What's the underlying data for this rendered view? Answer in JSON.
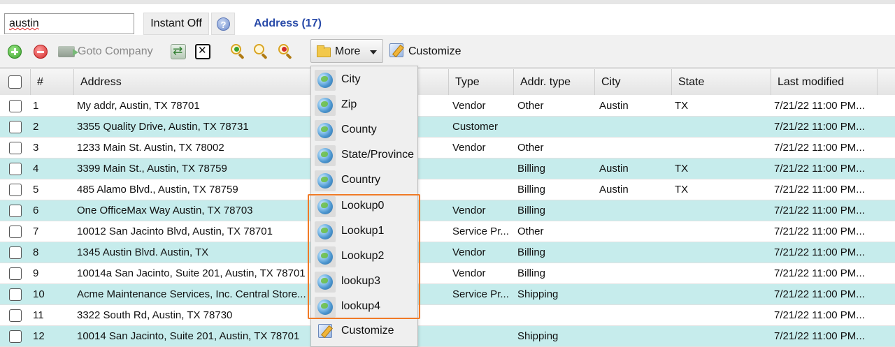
{
  "search": {
    "value": "austin"
  },
  "topbar": {
    "instant_label": "Instant Off",
    "help_glyph": "?",
    "title": "Address (17)"
  },
  "toolbar": {
    "goto_label": "Goto Company",
    "more_label": "More",
    "customize_label": "Customize",
    "icons": [
      "add-icon",
      "remove-icon",
      "goto-company-icon",
      "refresh-icon",
      "clear-icon",
      "search-add-icon",
      "search-icon",
      "search-remove-icon",
      "folder-icon",
      "customize-icon"
    ]
  },
  "table": {
    "columns": [
      "#",
      "Address",
      "Type",
      "Addr. type",
      "City",
      "State",
      "Last modified"
    ],
    "rows": [
      [
        "1",
        "My addr, Austin, TX 78701",
        "Vendor",
        "Other",
        "Austin",
        "TX",
        "7/21/22 11:00 PM..."
      ],
      [
        "2",
        "3355 Quality Drive, Austin, TX 78731",
        "Customer",
        "",
        "",
        "",
        "7/21/22 11:00 PM..."
      ],
      [
        "3",
        "1233 Main St. Austin, TX 78002",
        "Vendor",
        "Other",
        "",
        "",
        "7/21/22 11:00 PM..."
      ],
      [
        "4",
        "3399 Main St., Austin, TX 78759",
        "",
        "Billing",
        "Austin",
        "TX",
        "7/21/22 11:00 PM..."
      ],
      [
        "5",
        "485 Alamo Blvd., Austin, TX 78759",
        "",
        "Billing",
        "Austin",
        "TX",
        "7/21/22 11:00 PM..."
      ],
      [
        "6",
        "One OfficeMax Way Austin, TX 78703",
        "Vendor",
        "Billing",
        "",
        "",
        "7/21/22 11:00 PM..."
      ],
      [
        "7",
        "10012 San Jacinto Blvd, Austin, TX 78701",
        "Service Pr...",
        "Other",
        "",
        "",
        "7/21/22 11:00 PM..."
      ],
      [
        "8",
        "1345 Austin Blvd. Austin, TX",
        "Vendor",
        "Billing",
        "",
        "",
        "7/21/22 11:00 PM..."
      ],
      [
        "9",
        "10014a San Jacinto, Suite 201, Austin, TX 78701",
        "Vendor",
        "Billing",
        "",
        "",
        "7/21/22 11:00 PM..."
      ],
      [
        "10",
        "Acme Maintenance Services, Inc. Central Store...",
        "Service Pr...",
        "Shipping",
        "",
        "",
        "7/21/22 11:00 PM..."
      ],
      [
        "11",
        "3322 South Rd, Austin, TX 78730",
        "",
        "",
        "",
        "",
        "7/21/22 11:00 PM..."
      ],
      [
        "12",
        "10014 San Jacinto, Suite 201, Austin, TX 78701",
        "",
        "Shipping",
        "",
        "",
        "7/21/22 11:00 PM..."
      ]
    ]
  },
  "menu": {
    "items": [
      {
        "label": "City",
        "icon": "globe-icon"
      },
      {
        "label": "Zip",
        "icon": "globe-icon"
      },
      {
        "label": "County",
        "icon": "globe-icon"
      },
      {
        "label": "State/Province",
        "icon": "globe-icon"
      },
      {
        "label": "Country",
        "icon": "globe-icon"
      },
      {
        "label": "Lookup0",
        "icon": "globe-icon"
      },
      {
        "label": "Lookup1",
        "icon": "globe-icon"
      },
      {
        "label": "Lookup2",
        "icon": "globe-icon"
      },
      {
        "label": "lookup3",
        "icon": "globe-icon"
      },
      {
        "label": "lookup4",
        "icon": "globe-icon"
      },
      {
        "label": "Customize",
        "icon": "customize-icon"
      }
    ]
  },
  "colors": {
    "row_alt": "#c6ecec",
    "title_link": "#2749a8",
    "highlight": "#f07a26"
  }
}
